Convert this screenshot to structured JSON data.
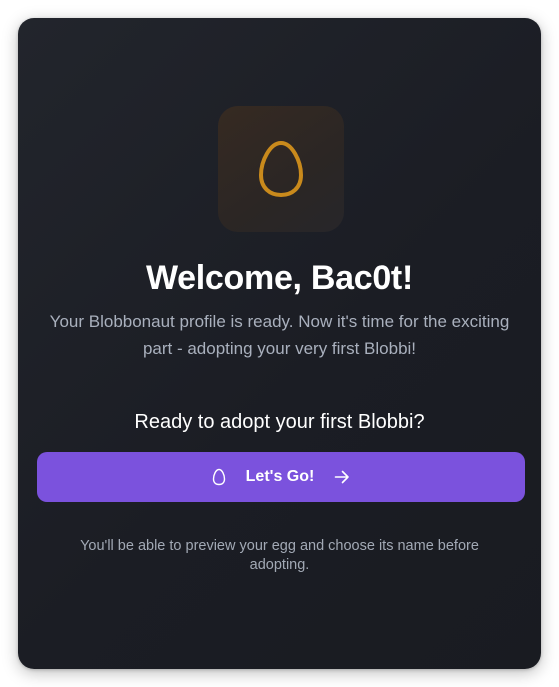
{
  "welcome": {
    "icon": "egg-icon",
    "title": "Welcome, Bac0t!",
    "subtitle": "Your Blobbonaut profile is ready. Now it's time for the exciting part - adopting your very first Blobbi!",
    "prompt": "Ready to adopt your first Blobbi?",
    "cta": {
      "label": "Let's Go!",
      "leading_icon": "egg-outline-icon",
      "trailing_icon": "arrow-right-icon"
    },
    "note": "You'll be able to preview your egg and choose its name before adopting."
  },
  "colors": {
    "card_background": "#1e2027",
    "egg_accent": "#c98a1c",
    "button_background": "#7b52dd",
    "muted_text": "#a9b0bd"
  }
}
